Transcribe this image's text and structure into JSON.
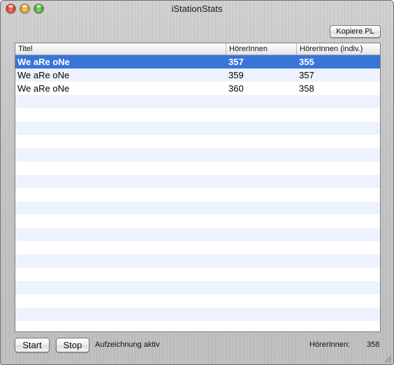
{
  "window": {
    "title": "iStationStats"
  },
  "toolbar": {
    "copy_label": "Kopiere PL"
  },
  "table": {
    "columns": [
      "Titel",
      "HörerInnen",
      "HörerInnen (indiv.)"
    ],
    "rows": [
      {
        "title": "We aRe oNe",
        "listeners": "357",
        "listeners_indiv": "355",
        "selected": true
      },
      {
        "title": "We aRe oNe",
        "listeners": "359",
        "listeners_indiv": "357",
        "selected": false
      },
      {
        "title": "We aRe oNe",
        "listeners": "360",
        "listeners_indiv": "358",
        "selected": false
      }
    ],
    "selection_color": "#3875d7",
    "stripe_color": "#edf3fe"
  },
  "footer": {
    "start_label": "Start",
    "stop_label": "Stop",
    "status_text": "Aufzeichnung aktiv",
    "count_label": "HörerInnen:",
    "count_value": "358"
  },
  "icons": {
    "close": "close-button",
    "minimize": "minimize-button",
    "zoom": "zoom-button",
    "resize": "resize-grip-icon"
  }
}
